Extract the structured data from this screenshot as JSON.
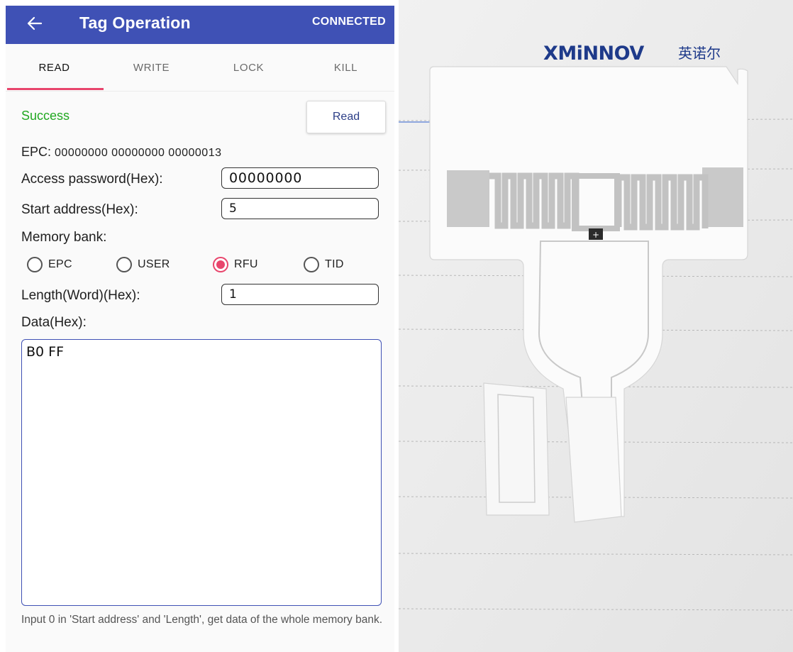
{
  "app_bar": {
    "title": "Tag Operation",
    "status": "CONNECTED",
    "color": "#3f51b5"
  },
  "tabs": [
    {
      "label": "READ",
      "active": true
    },
    {
      "label": "WRITE",
      "active": false
    },
    {
      "label": "LOCK",
      "active": false
    },
    {
      "label": "KILL",
      "active": false
    }
  ],
  "accent_color": "#e8456c",
  "status": {
    "text": "Success",
    "color": "#21a821"
  },
  "read_button": "Read",
  "epc": {
    "label": "EPC:",
    "value": "00000000 00000000 00000013"
  },
  "access_password": {
    "label": "Access password(Hex):",
    "value": "00000000"
  },
  "start_address": {
    "label": "Start address(Hex):",
    "value": "5"
  },
  "memory_bank": {
    "label": "Memory bank:",
    "options": [
      "EPC",
      "USER",
      "RFU",
      "TID"
    ],
    "selected": "RFU"
  },
  "length": {
    "label": "Length(Word)(Hex):",
    "value": "1"
  },
  "data": {
    "label": "Data(Hex):",
    "value": "B0 FF"
  },
  "hint": "Input 0 in 'Start address' and 'Length', get data of the whole memory bank.",
  "photo": {
    "brand": "XMiNNOV",
    "brand_cn": "英诺尔"
  }
}
